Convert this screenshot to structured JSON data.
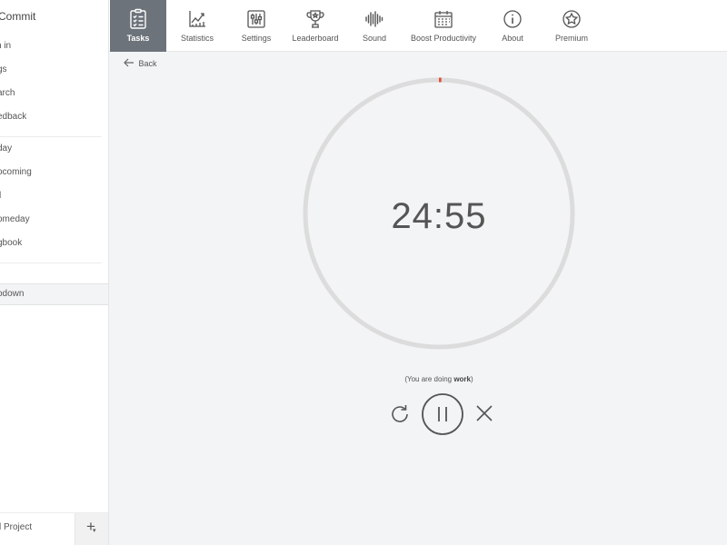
{
  "app": {
    "title": "Commit"
  },
  "sidebar": {
    "account": [
      {
        "name": "sidebar-item-sign-in",
        "label": "n in"
      },
      {
        "name": "sidebar-item-tags",
        "label": "gs"
      },
      {
        "name": "sidebar-item-search",
        "label": "arch"
      },
      {
        "name": "sidebar-item-feedback",
        "label": "edback"
      }
    ],
    "lists": [
      {
        "name": "sidebar-item-today",
        "label": "day"
      },
      {
        "name": "sidebar-item-upcoming",
        "label": "ocoming"
      },
      {
        "name": "sidebar-item-all",
        "label": "l"
      },
      {
        "name": "sidebar-item-someday",
        "label": "omeday"
      },
      {
        "name": "sidebar-item-logbook",
        "label": "gbook"
      }
    ],
    "selected": {
      "label": "odown"
    },
    "footer": {
      "project_label": "l Project",
      "add_symbol": "+",
      "caret_symbol": "▾"
    }
  },
  "nav": {
    "items": [
      {
        "id": "tasks",
        "label": "Tasks",
        "icon": "clipboard-icon",
        "active": true
      },
      {
        "id": "statistics",
        "label": "Statistics",
        "icon": "chart-icon",
        "active": false
      },
      {
        "id": "settings",
        "label": "Settings",
        "icon": "sliders-icon",
        "active": false
      },
      {
        "id": "leaderboard",
        "label": "Leaderboard",
        "icon": "trophy-icon",
        "active": false
      },
      {
        "id": "sound",
        "label": "Sound",
        "icon": "soundwave-icon",
        "active": false
      },
      {
        "id": "boost",
        "label": "Boost Productivity",
        "icon": "calendar-icon",
        "active": false
      },
      {
        "id": "about",
        "label": "About",
        "icon": "info-icon",
        "active": false
      },
      {
        "id": "premium",
        "label": "Premium",
        "icon": "star-badge-icon",
        "active": false
      }
    ]
  },
  "main": {
    "back_label": "Back",
    "timer": "24:55",
    "progress": 0.003,
    "status_prefix": "(You are doing ",
    "status_mode": "work",
    "status_suffix": ")"
  },
  "colors": {
    "ring_track": "#dcdcdc",
    "ring_progress": "#e74c3c",
    "nav_active": "#6d737b",
    "control": "#555555"
  }
}
